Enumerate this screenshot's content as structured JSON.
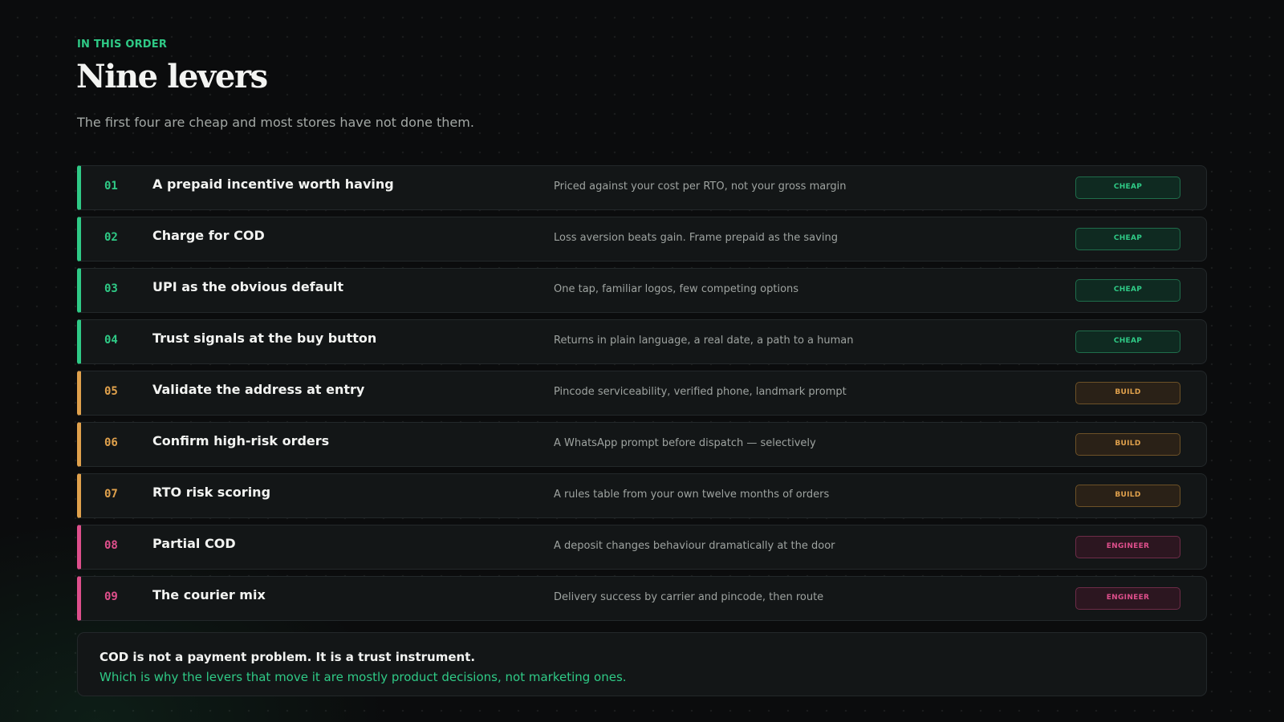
{
  "header": {
    "eyebrow": "IN THIS ORDER",
    "title": "Nine levers",
    "subtitle": "The first four are cheap and most stores have not done them."
  },
  "colors": {
    "cheap": "#2fca86",
    "build": "#e0a14c",
    "engineer": "#df4f8c",
    "background": "#0b0c0d"
  },
  "levers": [
    {
      "number": "01",
      "title": "A prepaid incentive worth having",
      "note": "Priced against your cost per RTO, not your gross margin",
      "tag": "CHEAP",
      "category": "cheap"
    },
    {
      "number": "02",
      "title": "Charge for COD",
      "note": "Loss aversion beats gain. Frame prepaid as the saving",
      "tag": "CHEAP",
      "category": "cheap"
    },
    {
      "number": "03",
      "title": "UPI as the obvious default",
      "note": "One tap, familiar logos, few competing options",
      "tag": "CHEAP",
      "category": "cheap"
    },
    {
      "number": "04",
      "title": "Trust signals at the buy button",
      "note": "Returns in plain language, a real date, a path to a human",
      "tag": "CHEAP",
      "category": "cheap"
    },
    {
      "number": "05",
      "title": "Validate the address at entry",
      "note": "Pincode serviceability, verified phone, landmark prompt",
      "tag": "BUILD",
      "category": "build"
    },
    {
      "number": "06",
      "title": "Confirm high-risk orders",
      "note": "A WhatsApp prompt before dispatch — selectively",
      "tag": "BUILD",
      "category": "build"
    },
    {
      "number": "07",
      "title": "RTO risk scoring",
      "note": "A rules table from your own twelve months of orders",
      "tag": "BUILD",
      "category": "build"
    },
    {
      "number": "08",
      "title": "Partial COD",
      "note": "A deposit changes behaviour dramatically at the door",
      "tag": "ENGINEER",
      "category": "engineer"
    },
    {
      "number": "09",
      "title": "The courier mix",
      "note": "Delivery success by carrier and pincode, then route",
      "tag": "ENGINEER",
      "category": "engineer"
    }
  ],
  "callout": {
    "main": "COD is not a payment problem. It is a trust instrument.",
    "sub": "Which is why the levers that move it are mostly product decisions, not marketing ones."
  }
}
